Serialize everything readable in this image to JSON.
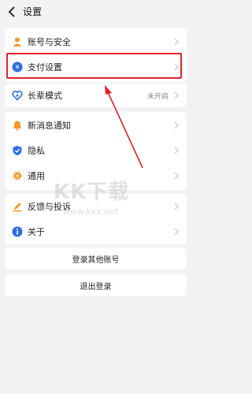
{
  "header": {
    "title": "设置"
  },
  "groups": {
    "account": {
      "label": "账号与安全"
    },
    "payment": {
      "label": "支付设置"
    },
    "elder": {
      "label": "长辈模式",
      "value": "未开启"
    },
    "notify": {
      "label": "新消息通知"
    },
    "privacy": {
      "label": "隐私"
    },
    "general": {
      "label": "通用"
    },
    "feedback": {
      "label": "反馈与投诉"
    },
    "about": {
      "label": "关于"
    }
  },
  "actions": {
    "login_other": "登录其他账号",
    "logout": "退出登录"
  },
  "watermark": {
    "main": "KK下载",
    "sub": "www.kkx.net"
  },
  "colors": {
    "icon_orange": "#f39a2b",
    "icon_blue": "#2f6de1",
    "highlight": "#e0202a",
    "background": "#f2f2f4"
  }
}
